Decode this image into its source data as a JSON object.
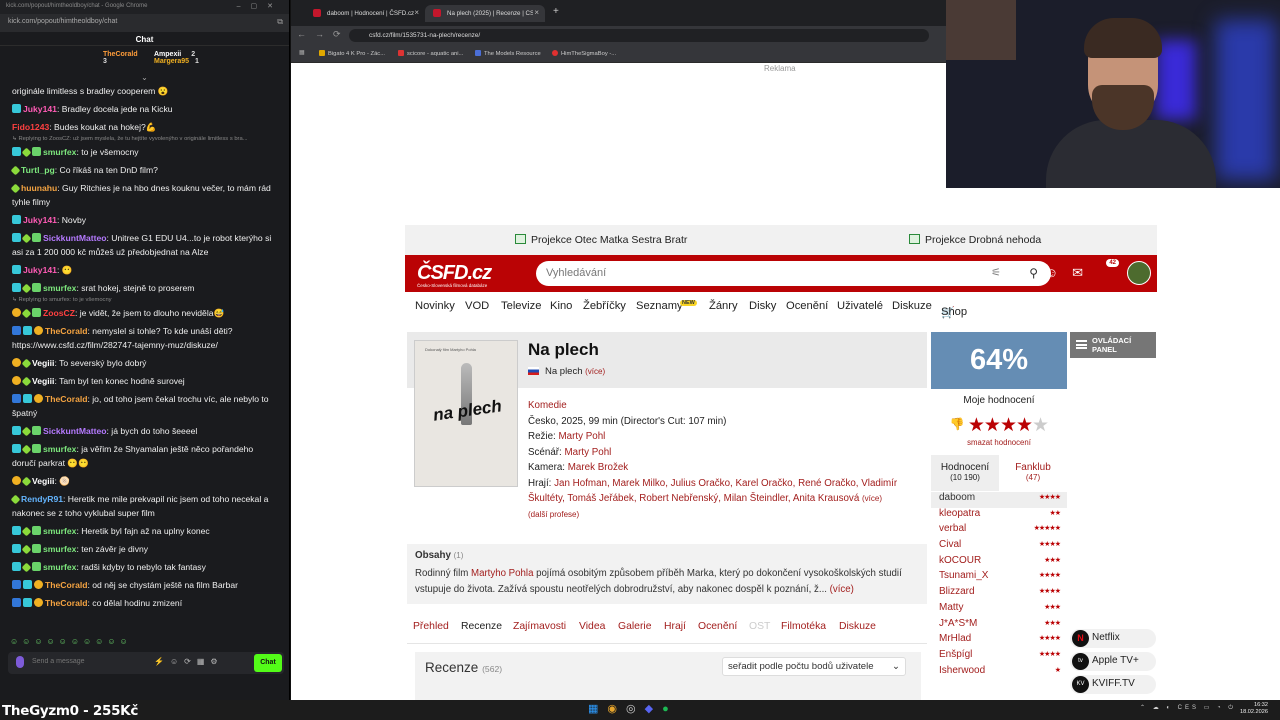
{
  "chat_window": {
    "title": "kick.com/popout/himtheoldboy/chat - Google Chrome",
    "url": "kick.com/popout/himtheoldboy/chat",
    "header": "Chat",
    "pinned": [
      {
        "name": "TheCorald",
        "count": "3"
      },
      {
        "name": "Ampexii",
        "count": "2"
      },
      {
        "name": "Margera95",
        "count": "1"
      }
    ],
    "messages": [
      {
        "reply": "",
        "user": "",
        "ucls": "white",
        "badges": [],
        "text": "originále limitless s bradley cooperem 😮"
      },
      {
        "reply": "",
        "user": "Juky141",
        "ucls": "pink",
        "badges": [
          "cyan"
        ],
        "text": ": Bradley docela jede na Kicku"
      },
      {
        "reply": "",
        "user": "Fido1243",
        "ucls": "red",
        "badges": [],
        "text": ": Budes koukat na hokej?💪"
      },
      {
        "reply": "↳ Replying to ZoosCZ: už jsem myslela, že tu hejtíte vyvolenýho v originále limitless s bra...",
        "user": "smurfex",
        "ucls": "green",
        "badges": [
          "cyan",
          "leaf",
          "green"
        ],
        "text": ": to je všemocny"
      },
      {
        "reply": "",
        "user": "Turtl_pg",
        "ucls": "green",
        "badges": [
          "leaf"
        ],
        "text": ": Co říkáš na ten DnD film?"
      },
      {
        "reply": "",
        "user": "huunahu",
        "ucls": "orange",
        "badges": [
          "leaf"
        ],
        "text": ": Guy Ritchies je na hbo dnes kouknu večer, to mám rád tyhle filmy"
      },
      {
        "reply": "",
        "user": "Juky141",
        "ucls": "pink",
        "badges": [
          "cyan"
        ],
        "text": ": Novby"
      },
      {
        "reply": "",
        "user": "SickkuntMatteo",
        "ucls": "purple",
        "badges": [
          "cyan",
          "leaf",
          "green"
        ],
        "text": ": Unitree G1 EDU U4...to je robot kterýho si asi za 1 200 000 kč můžeš už předobjednat na Alze"
      },
      {
        "reply": "",
        "user": "Juky141",
        "ucls": "pink",
        "badges": [
          "cyan"
        ],
        "text": ": 😶"
      },
      {
        "reply": "",
        "user": "smurfex",
        "ucls": "green",
        "badges": [
          "cyan",
          "leaf",
          "green"
        ],
        "text": ": srat hokej, stejně to proserem"
      },
      {
        "reply": "↳ Replying to smurfex: to je všemocny",
        "user": "ZoosCZ",
        "ucls": "red",
        "badges": [
          "yel",
          "leaf",
          "green"
        ],
        "text": ": je vidět, že jsem to dlouho neviděla😅"
      },
      {
        "reply": "",
        "user": "TheCorald",
        "ucls": "orange",
        "badges": [
          "blue",
          "cyan",
          "yel"
        ],
        "text": ": nemyslel si tohle? To kde unáší děti? https://www.csfd.cz/film/282747-tajemny-muz/diskuze/"
      },
      {
        "reply": "",
        "user": "Vegiii",
        "ucls": "white",
        "badges": [
          "yel",
          "leaf"
        ],
        "text": ": To severský bylo dobrý"
      },
      {
        "reply": "",
        "user": "Vegiii",
        "ucls": "white",
        "badges": [
          "yel",
          "leaf"
        ],
        "text": ": Tam byl ten konec hodně surovej"
      },
      {
        "reply": "",
        "user": "TheCorald",
        "ucls": "orange",
        "badges": [
          "blue",
          "cyan",
          "yel"
        ],
        "text": ": jo, od toho jsem čekal trochu víc, ale nebylo to špatný"
      },
      {
        "reply": "",
        "user": "SickkuntMatteo",
        "ucls": "purple",
        "badges": [
          "cyan",
          "leaf",
          "green"
        ],
        "text": ": já bych do toho šeeeel"
      },
      {
        "reply": "",
        "user": "smurfex",
        "ucls": "green",
        "badges": [
          "cyan",
          "leaf",
          "green"
        ],
        "text": ": ja věřim že Shyamalan ještě něco pořandeho doručí parkrat 😶😶"
      },
      {
        "reply": "",
        "user": "Vegiii",
        "ucls": "white",
        "badges": [
          "yel",
          "leaf"
        ],
        "text": ": 🫓"
      },
      {
        "reply": "",
        "user": "RendyR91",
        "ucls": "blue",
        "badges": [
          "leaf"
        ],
        "text": ": Heretik me mile prekvapil nic jsem od toho necekal a nakonec se z toho vyklubal super film"
      },
      {
        "reply": "",
        "user": "smurfex",
        "ucls": "green",
        "badges": [
          "cyan",
          "leaf",
          "green"
        ],
        "text": ": Heretik byl fajn až na uplny konec"
      },
      {
        "reply": "",
        "user": "smurfex",
        "ucls": "green",
        "badges": [
          "cyan",
          "leaf",
          "green"
        ],
        "text": ": ten závěr je divny"
      },
      {
        "reply": "",
        "user": "smurfex",
        "ucls": "green",
        "badges": [
          "cyan",
          "leaf",
          "green"
        ],
        "text": ": radši kdyby to nebylo tak fantasy"
      },
      {
        "reply": "",
        "user": "TheCorald",
        "ucls": "orange",
        "badges": [
          "blue",
          "cyan",
          "yel"
        ],
        "text": ": od něj se chystám ještě na film Barbar"
      },
      {
        "reply": "",
        "user": "TheCorald",
        "ucls": "orange",
        "badges": [
          "blue",
          "cyan",
          "yel"
        ],
        "text": ": co dělal hodinu zmizení"
      }
    ],
    "input_placeholder": "Send a message",
    "chat_button": "Chat"
  },
  "browser": {
    "tabs": [
      {
        "label": "daboom | Hodnocení | ČSFD.cz",
        "active": false
      },
      {
        "label": "Na plech (2025) | Recenze | ČSFD.cz",
        "active": true
      }
    ],
    "url": "csfd.cz/film/1535731-na-plech/recenze/",
    "bookmarks": [
      "Bigato 4 K Pro - Zác...",
      "scicore - aquatic ani...",
      "The Models Resource",
      "HimTheSigmaBoy -..."
    ]
  },
  "page": {
    "ad_label": "Reklama",
    "promos": [
      "Projekce Otec Matka Sestra Bratr",
      "Projekce Drobná nehoda"
    ],
    "logo": "ČSFD.cz",
    "logo_sub": "Česko-Slovenská filmová databáze",
    "search_placeholder": "Vyhledávání",
    "notif_count": "42",
    "nav": [
      "Novinky",
      "VOD",
      "Televize",
      "Kino",
      "Žebříčky",
      "Seznamy",
      "Žánry",
      "Disky",
      "Ocenění",
      "Uživatelé",
      "Diskuze",
      "Shop"
    ],
    "nav_new_badge": "NEW",
    "film": {
      "poster_title": "na plech",
      "poster_top": "Dokonalý film Martyho Pohla",
      "title": "Na plech",
      "orig_title": "Na plech",
      "orig_more": "(více)",
      "genre": "Komedie",
      "origin": "Česko, 2025, 99 min (Director's Cut: 107 min)",
      "rezie_label": "Režie:",
      "rezie": "Marty Pohl",
      "scenar_label": "Scénář:",
      "scenar": "Marty Pohl",
      "kamera_label": "Kamera:",
      "kamera": "Marek Brožek",
      "hraji_label": "Hrají:",
      "hraji": "Jan Hofman, Marek Milko, Julius Oračko, Karel Oračko, René Oračko, Vladimír Škultéty, Tomáš Jeřábek, Robert Nebřenský, Milan Šteindler, Anita Krausová",
      "hraji_more": "(více)",
      "profese": "(další profese)"
    },
    "plot": {
      "header": "Obsahy",
      "count": "(1)",
      "text_pre": "Rodinný film ",
      "text_link": "Martyho Pohla",
      "text_post": " pojímá osobitým způsobem příběh Marka, který po dokončení vysokoškolských studií vstupuje do života. Zažívá spoustu neotřelých dobrodružství, aby nakonec dospěl k poznání, ž... ",
      "more": "(více)"
    },
    "subtabs": [
      "Přehled",
      "Recenze",
      "Zajímavosti",
      "Videa",
      "Galerie",
      "Hrají",
      "Ocenění",
      "OST",
      "Filmotéka",
      "Diskuze"
    ],
    "reviews": {
      "title": "Recenze",
      "count": "(562)",
      "sort": "seřadit podle počtu bodů uživatele"
    },
    "rating": {
      "percent": "64%",
      "my_label": "Moje hodnocení",
      "my_stars": 4,
      "delete": "smazat hodnocení",
      "tab1": "Hodnocení",
      "tab1_count": "(10 190)",
      "tab2": "Fanklub",
      "tab2_count": "(47)",
      "users": [
        {
          "name": "daboom",
          "stars": 4
        },
        {
          "name": "kleopatra",
          "stars": 2
        },
        {
          "name": "verbal",
          "stars": 5
        },
        {
          "name": "Cival",
          "stars": 4
        },
        {
          "name": "kOCOUR",
          "stars": 3
        },
        {
          "name": "Tsunami_X",
          "stars": 4
        },
        {
          "name": "Blizzard",
          "stars": 4
        },
        {
          "name": "Matty",
          "stars": 3
        },
        {
          "name": "J*A*S*M",
          "stars": 3
        },
        {
          "name": "MrHlad",
          "stars": 4
        },
        {
          "name": "Enšpígl",
          "stars": 4
        },
        {
          "name": "Isherwood",
          "stars": 1
        }
      ]
    },
    "side_panel": "OVLÁDACÍ PANEL",
    "vod": [
      {
        "label": "Netflix",
        "icon": "N"
      },
      {
        "label": "Apple TV+",
        "icon": "tv"
      },
      {
        "label": "KVIFF.TV",
        "icon": "KV"
      }
    ]
  },
  "overlay": {
    "streamer": "TheGyzm0 - 255Kč"
  },
  "taskbar": {
    "tray": "CES",
    "time": "16:32",
    "date": "18.02.2026"
  }
}
